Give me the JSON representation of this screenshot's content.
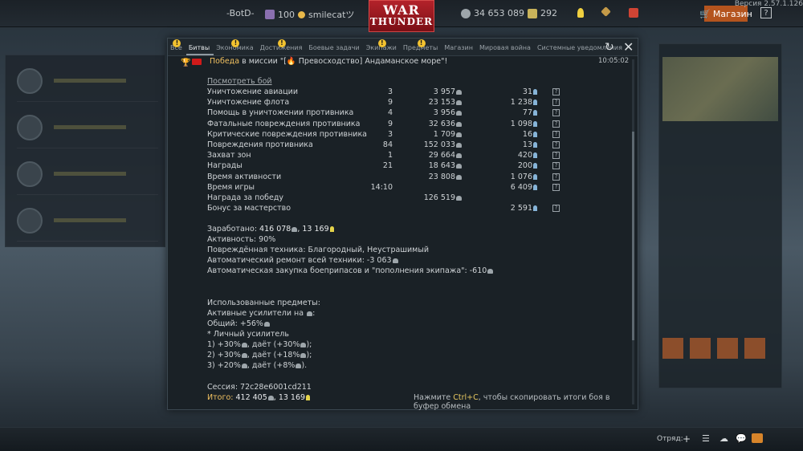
{
  "topbar": {
    "nickname_left": "-BotD-",
    "level": "100",
    "username": "smilecatツ",
    "logo_line1": "WAR",
    "logo_line2": "THUNDER",
    "silver_lions": "34 653 089",
    "eagles": "292",
    "shop_label": "Магазин",
    "help_label": "?",
    "version": "Версия 2.57.1.126"
  },
  "modal": {
    "tabs": [
      {
        "label": "Все",
        "warn": true,
        "active": false
      },
      {
        "label": "Битвы",
        "warn": false,
        "active": true
      },
      {
        "label": "Экономика",
        "warn": true,
        "active": false
      },
      {
        "label": "Достижения",
        "warn": true,
        "active": false
      },
      {
        "label": "Боевые задачи",
        "warn": false,
        "active": false
      },
      {
        "label": "Экипажи",
        "warn": true,
        "active": false
      },
      {
        "label": "Предметы",
        "warn": true,
        "active": false
      },
      {
        "label": "Магазин",
        "warn": false,
        "active": false
      },
      {
        "label": "Мировая война",
        "warn": false,
        "active": false
      },
      {
        "label": "Системные уведомления",
        "warn": false,
        "active": false
      }
    ],
    "warn_glyph": "!",
    "refresh_glyph": "↻",
    "close_glyph": "✕",
    "mission": {
      "result": "Победа",
      "text": " в миссии \"[🔥 Превосходство] Андаманское море\"!",
      "time": "10:05:02"
    },
    "view_battle_link": "Посмотреть бой",
    "rows": [
      {
        "name": "Уничтожение авиации",
        "count": "3",
        "sl": "3 957",
        "rp": "31",
        "gold": false
      },
      {
        "name": "Уничтожение флота",
        "count": "9",
        "sl": "23 153",
        "rp": "1 238",
        "gold": false
      },
      {
        "name": "Помощь в уничтожении противника",
        "count": "4",
        "sl": "3 956",
        "rp": "77",
        "gold": false
      },
      {
        "name": "Фатальные повреждения противника",
        "count": "9",
        "sl": "32 636",
        "rp": "1 098",
        "gold": false
      },
      {
        "name": "Критические повреждения противника",
        "count": "3",
        "sl": "1 709",
        "rp": "16",
        "gold": false
      },
      {
        "name": "Повреждения противника",
        "count": "84",
        "sl": "152 033",
        "rp": "13",
        "gold": false
      },
      {
        "name": "Захват зон",
        "count": "1",
        "sl": "29 664",
        "rp": "420",
        "gold": false
      },
      {
        "name": "Награды",
        "count": "21",
        "sl": "18 643",
        "rp": "200",
        "gold": false
      },
      {
        "name": "Время активности",
        "count": "",
        "sl": "23 808",
        "rp": "1 076",
        "gold": false
      },
      {
        "name": "Время игры",
        "count": "14:10",
        "sl": "",
        "rp": "6 409",
        "gold": false
      },
      {
        "name": "Награда за победу",
        "count": "",
        "sl": "126 519",
        "rp": "",
        "gold": false
      },
      {
        "name": "Бонус за мастерство",
        "count": "",
        "sl": "",
        "rp": "2 591",
        "gold": false
      }
    ],
    "earned_label": "Заработано: ",
    "earned_sl": "416 078",
    "earned_rp": ", 13 169",
    "activity": "Активность: 90%",
    "damaged_vehicles": "Повреждённая техника: Благородный, Неустрашимый",
    "repair": "Автоматический ремонт всей техники: -3 063",
    "ammo_purchase": "Автоматическая закупка боеприпасов и \"пополнения экипажа\": -610",
    "items_header": "Использованные предметы:",
    "boosters_active": "Активные усилители на",
    "boosters_total": "Общий: +56%",
    "personal_booster": "* Личный усилитель",
    "booster_1": "1) +30%",
    "booster_1b": ", даёт (+30%",
    "booster_2": "2) +30%",
    "booster_2b": ", даёт (+18%",
    "booster_3": "3) +20%",
    "booster_3b": ", даёт (+8%",
    "session": "Сессия: 72c28e6001cd211",
    "total_label": "Итого: ",
    "total_sl": "412 405",
    "total_rp": ", 13 169",
    "copy_hint_prefix": "Нажмите ",
    "copy_hint_key": "Ctrl+C",
    "copy_hint_suffix": ", чтобы скопировать итоги боя в буфер обмена",
    "question_glyph": "?"
  },
  "bottombar": {
    "squad_label": "Отряд:",
    "add_glyph": "+"
  },
  "colors": {
    "accent_orange": "#b4541e",
    "warn_yellow": "#f2c230",
    "victory_gold": "#f0c060",
    "rp_blue": "#86b4d8"
  }
}
